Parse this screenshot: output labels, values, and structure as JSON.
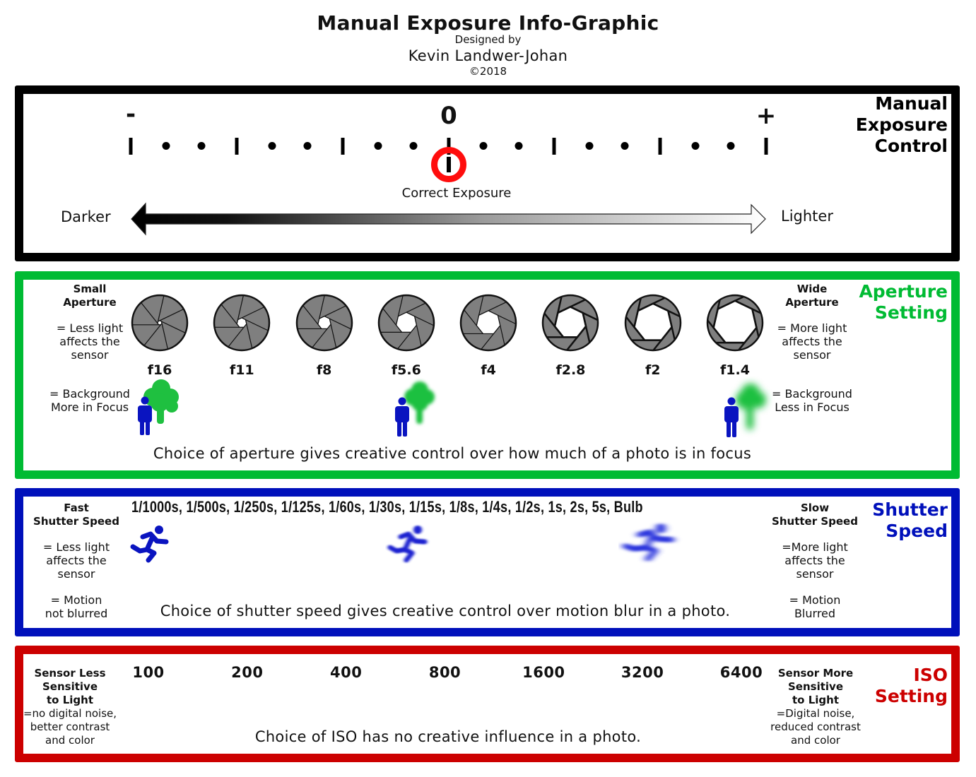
{
  "header": {
    "title": "Manual Exposure Info-Graphic",
    "designed_by": "Designed by",
    "author": "Kevin Landwer-Johan",
    "copyright": "©2018"
  },
  "colors": {
    "exposure_frame": "#000000",
    "aperture_frame": "#00bb33",
    "shutter_frame": "#0010bb",
    "iso_frame": "#cc0000",
    "indicator_ring": "#ff0d0d",
    "person": "#0a14c0",
    "tree": "#1fc040",
    "iris_blades": "#7f7f7f"
  },
  "exposure": {
    "title_lines": [
      "Manual",
      "Exposure",
      "Control"
    ],
    "minus_label": "-",
    "zero_label": "0",
    "plus_label": "+",
    "scale": {
      "min_stops": -3,
      "max_stops": 3,
      "marks_per_stop": 3,
      "indicator_stops": 0
    },
    "indicator_label": "Correct Exposure",
    "darker_label": "Darker",
    "lighter_label": "Lighter"
  },
  "aperture": {
    "title_lines": [
      "Aperture",
      "Setting"
    ],
    "left": {
      "head_lines": [
        "Small",
        "Aperture"
      ],
      "effect_lines": [
        "= Less light",
        "affects the",
        "sensor"
      ],
      "focus_lines": [
        "= Background",
        "More in Focus"
      ]
    },
    "right": {
      "head_lines": [
        "Wide",
        "Aperture"
      ],
      "effect_lines": [
        "= More light",
        "affects the",
        "sensor"
      ],
      "focus_lines": [
        "= Background",
        "Less in Focus"
      ]
    },
    "stops": [
      {
        "label": "f16",
        "opening": 0.08
      },
      {
        "label": "f11",
        "opening": 0.18
      },
      {
        "label": "f8",
        "opening": 0.24
      },
      {
        "label": "f5.6",
        "opening": 0.38
      },
      {
        "label": "f4",
        "opening": 0.44
      },
      {
        "label": "f2.8",
        "opening": 0.58
      },
      {
        "label": "f2",
        "opening": 0.7
      },
      {
        "label": "f1.4",
        "opening": 0.8
      }
    ],
    "focus_examples": [
      {
        "at_stop": "f16",
        "background_blur": "sharp"
      },
      {
        "at_stop": "f5.6",
        "background_blur": "medium"
      },
      {
        "at_stop": "f1.4",
        "background_blur": "strong"
      }
    ],
    "caption": "Choice of aperture gives creative control over how much of a photo is in focus"
  },
  "shutter": {
    "title_lines": [
      "Shutter",
      "Speed"
    ],
    "left": {
      "head_lines": [
        "Fast",
        "Shutter Speed"
      ],
      "effect_lines": [
        "= Less light",
        "affects the",
        "sensor"
      ],
      "motion_lines": [
        "= Motion",
        "not blurred"
      ]
    },
    "right": {
      "head_lines": [
        "Slow",
        "Shutter Speed"
      ],
      "effect_lines": [
        "=More light",
        "affects the",
        "sensor"
      ],
      "motion_lines": [
        "= Motion",
        "Blurred"
      ]
    },
    "speeds": [
      "1/1000s",
      "1/500s",
      "1/250s",
      "1/125s",
      "1/60s",
      "1/30s",
      "1/15s",
      "1/8s",
      "1/4s",
      "1/2s",
      "1s",
      "2s",
      "5s",
      "Bulb"
    ],
    "speeds_text": "1/1000s,  1/500s,  1/250s,  1/125s,  1/60s,  1/30s,  1/15s,  1/8s,  1/4s,  1/2s,  1s,  2s,  5s, Bulb",
    "runner_examples": [
      {
        "motion_blur": "none"
      },
      {
        "motion_blur": "medium"
      },
      {
        "motion_blur": "strong"
      }
    ],
    "caption": "Choice of shutter speed gives creative control over motion blur in a photo."
  },
  "iso": {
    "title_lines": [
      "ISO",
      "Setting"
    ],
    "left": {
      "head_lines": [
        "Sensor Less",
        "Sensitive",
        "to Light"
      ],
      "effect_lines": [
        "=no digital noise,",
        "better contrast",
        "and color"
      ]
    },
    "right": {
      "head_lines": [
        "Sensor More",
        "Sensitive",
        "to Light"
      ],
      "effect_lines": [
        "=Digital noise,",
        "reduced contrast",
        "and color"
      ]
    },
    "values": [
      "100",
      "200",
      "400",
      "800",
      "1600",
      "3200",
      "6400"
    ],
    "caption": "Choice of ISO has no creative influence in a photo."
  }
}
